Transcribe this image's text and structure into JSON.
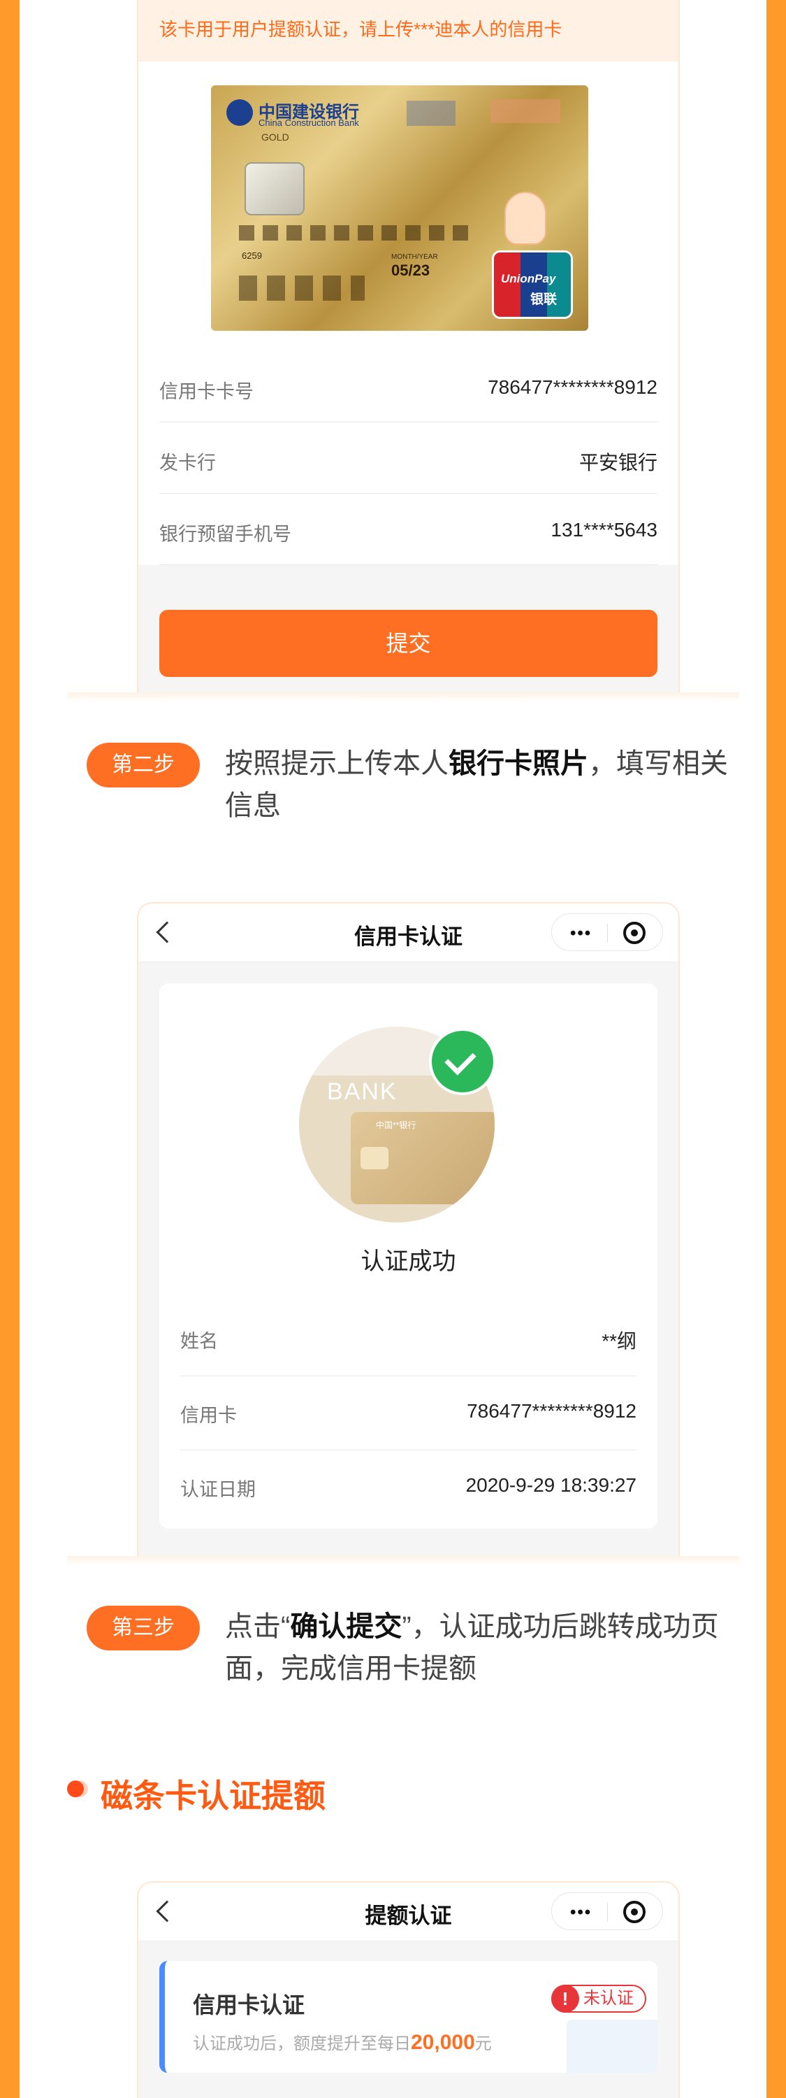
{
  "phone1": {
    "notice": "该卡用于用户提额认证，请上传***迪本人的信用卡",
    "card": {
      "bank_cn": "中国建设银行",
      "bank_en": "China Construction Bank",
      "tier": "GOLD",
      "prefix": "6259",
      "expiry_label": "MONTH/YEAR",
      "expiry": "05/23",
      "network_en": "UnionPay",
      "network_cn": "银联"
    },
    "rows": [
      {
        "label": "信用卡卡号",
        "value": "786477********8912"
      },
      {
        "label": "发卡行",
        "value": "平安银行"
      },
      {
        "label": "银行预留手机号",
        "value": "131****5643"
      }
    ],
    "submit_label": "提交"
  },
  "step2": {
    "badge": "第二步",
    "text_before": "按照提示上传本人",
    "text_bold": "银行卡照片",
    "text_after": "，填写相关信息"
  },
  "phone2": {
    "title": "信用卡认证",
    "illustration": {
      "bank_text": "BANK",
      "card_bank": "中国**银行"
    },
    "success_text": "认证成功",
    "rows": [
      {
        "label": "姓名",
        "value": "**纲"
      },
      {
        "label": "信用卡",
        "value": "786477********8912"
      },
      {
        "label": "认证日期",
        "value": "2020-9-29 18:39:27"
      }
    ]
  },
  "step3": {
    "badge": "第三步",
    "text_before": "点击“",
    "text_bold": "确认提交",
    "text_after": "”，认证成功后跳转成功页面，完成信用卡提额"
  },
  "section": {
    "title": "磁条卡认证提额"
  },
  "phone3": {
    "title": "提额认证",
    "card_title": "信用卡认证",
    "status": "未认证",
    "desc_before": "认证成功后，额度提升至每日",
    "amount": "20,000",
    "desc_after": "元"
  },
  "colors": {
    "accent": "#ff6f23",
    "frame": "#ff9a2b",
    "success": "#2bb85b",
    "status_red": "#e8353a"
  }
}
